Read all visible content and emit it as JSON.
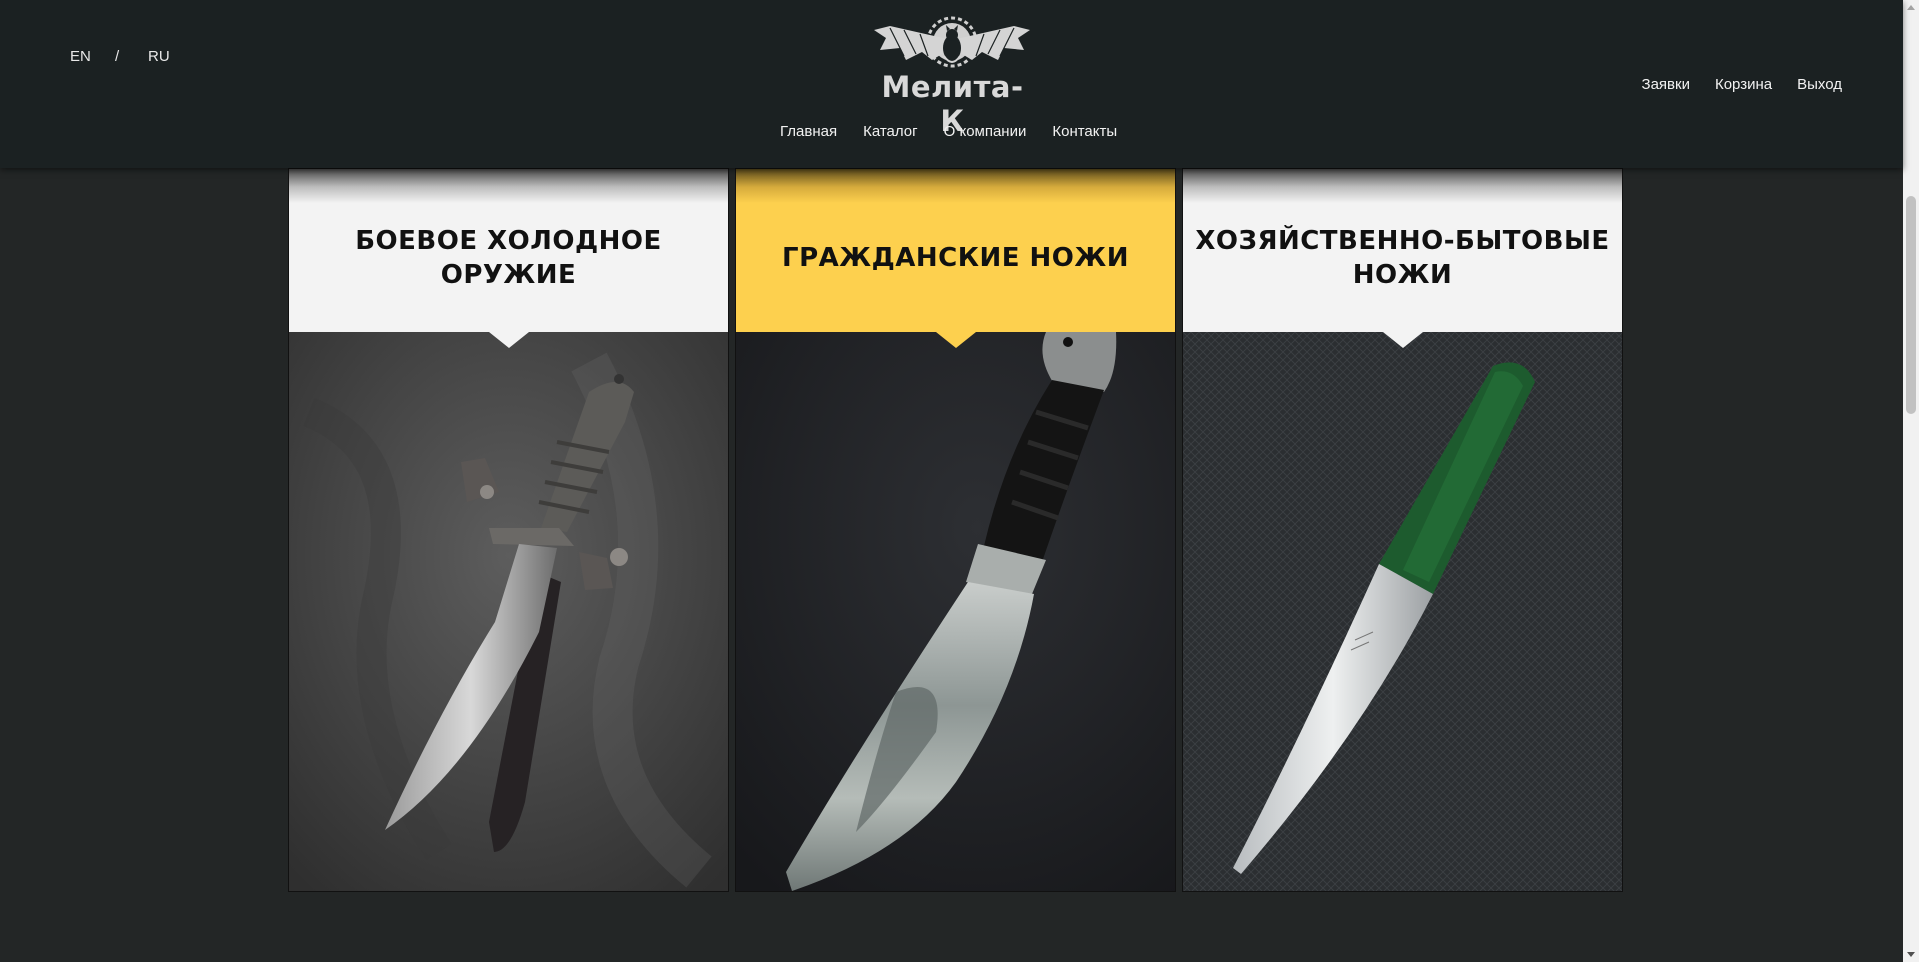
{
  "header": {
    "lang": {
      "en": "EN",
      "sep": "/",
      "ru": "RU"
    },
    "logo_text": "Мелита-К",
    "main_nav": [
      "Главная",
      "Каталог",
      "О компании",
      "Контакты"
    ],
    "user_nav": [
      "Заявки",
      "Корзина",
      "Выход"
    ]
  },
  "cards": [
    {
      "title": "БОЕВОЕ ХОЛОДНОЕ ОРУЖИЕ",
      "active": false
    },
    {
      "title": "ГРАЖДАНСКИЕ НОЖИ",
      "active": true
    },
    {
      "title": "ХОЗЯЙСТВЕННО-БЫТОВЫЕ НОЖИ",
      "active": false
    }
  ],
  "colors": {
    "header_bg": "#1b2122",
    "page_bg": "#232626",
    "card_head": "#f3f3f3",
    "card_active": "#fdd04e"
  }
}
